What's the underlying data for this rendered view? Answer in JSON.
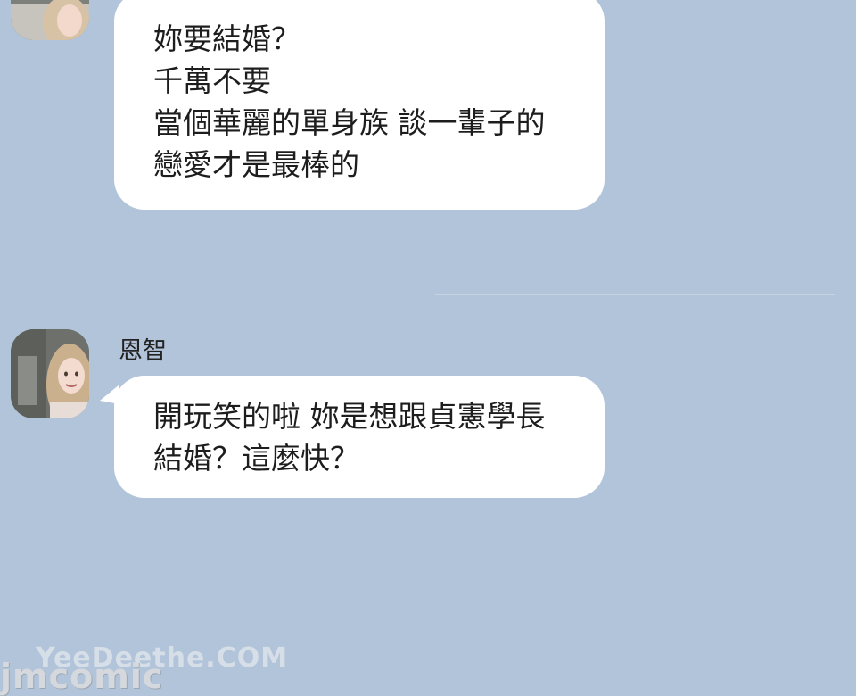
{
  "chat": {
    "messages": [
      {
        "sender": "",
        "lines": [
          "妳要結婚？",
          "千萬不要",
          "當個華麗的單身族 談一輩子的",
          "戀愛才是最棒的"
        ]
      },
      {
        "sender": "恩智",
        "lines": [
          "開玩笑的啦 妳是想跟貞憲學長",
          "結婚？這麼快？"
        ]
      }
    ]
  },
  "watermark": {
    "top": "YeeDeethe.COM",
    "bottom": "jmcomic"
  },
  "colors": {
    "background": "#b2c4da",
    "bubble": "#ffffff",
    "text": "#1d1d1d"
  }
}
